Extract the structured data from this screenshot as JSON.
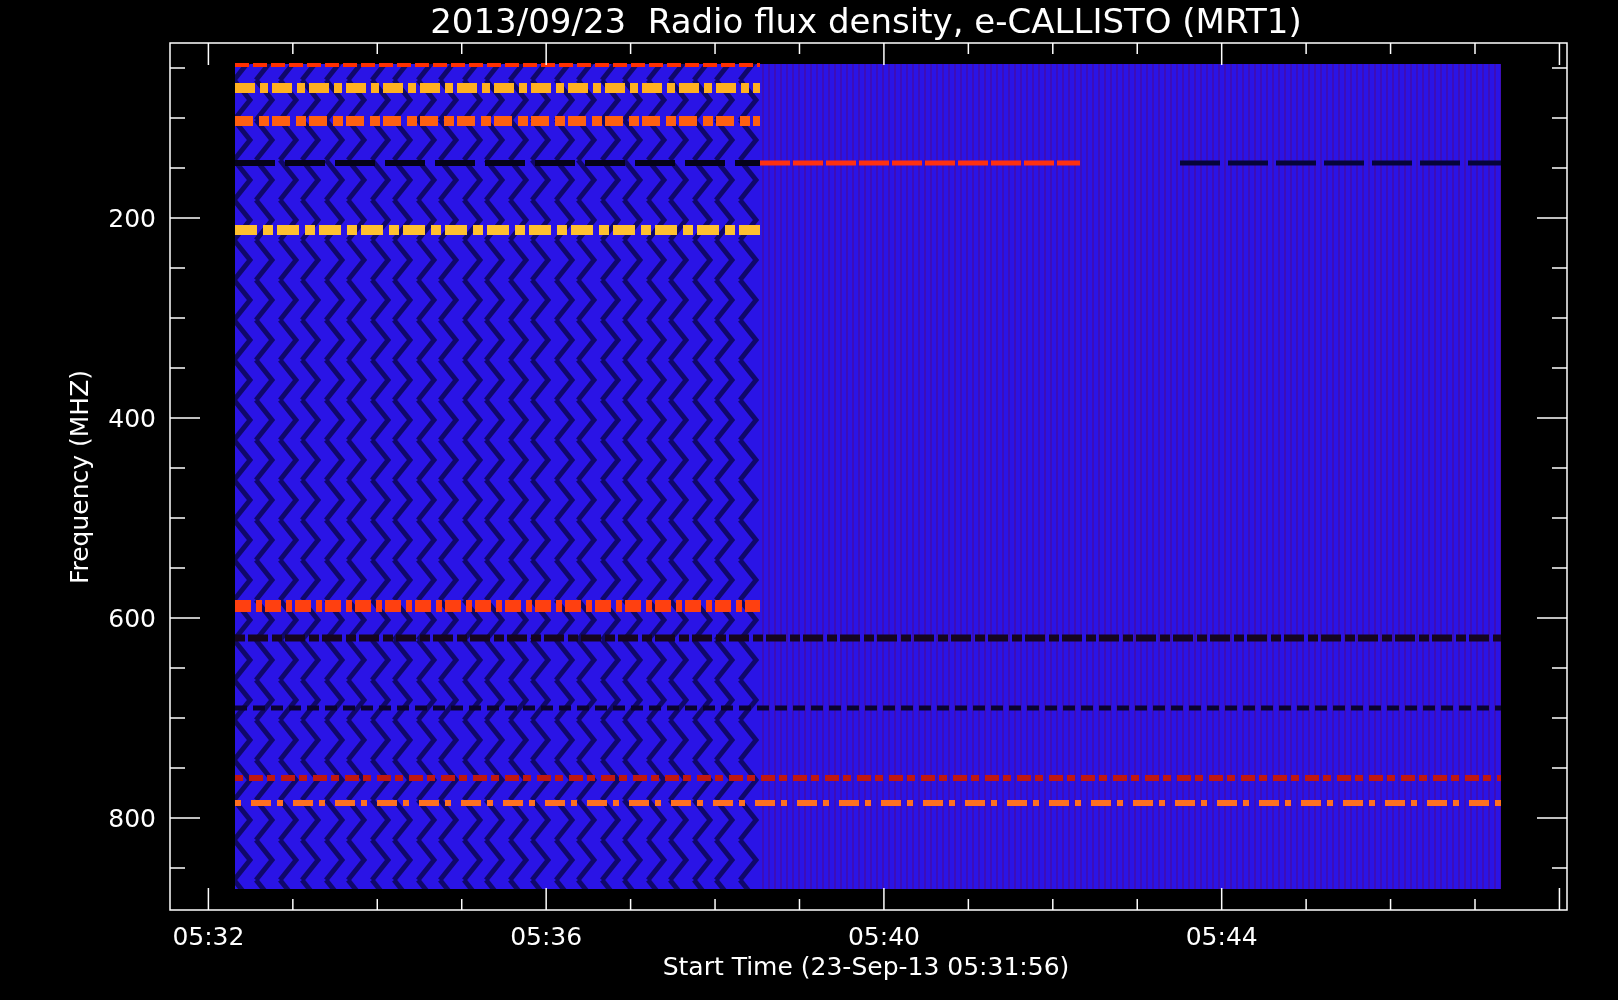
{
  "title": "2013/09/23  Radio flux density, e-CALLISTO (MRT1)",
  "plot": {
    "xlabel": "Start Time (23-Sep-13 05:31:56)",
    "ylabel": "Frequency (MHZ)",
    "xticks": [
      {
        "label": "05:32"
      },
      {
        "label": "05:36"
      },
      {
        "label": "05:40"
      },
      {
        "label": "05:44"
      }
    ],
    "yticks": [
      {
        "label": "200"
      },
      {
        "label": "400"
      },
      {
        "label": "600"
      },
      {
        "label": "800"
      }
    ]
  }
}
